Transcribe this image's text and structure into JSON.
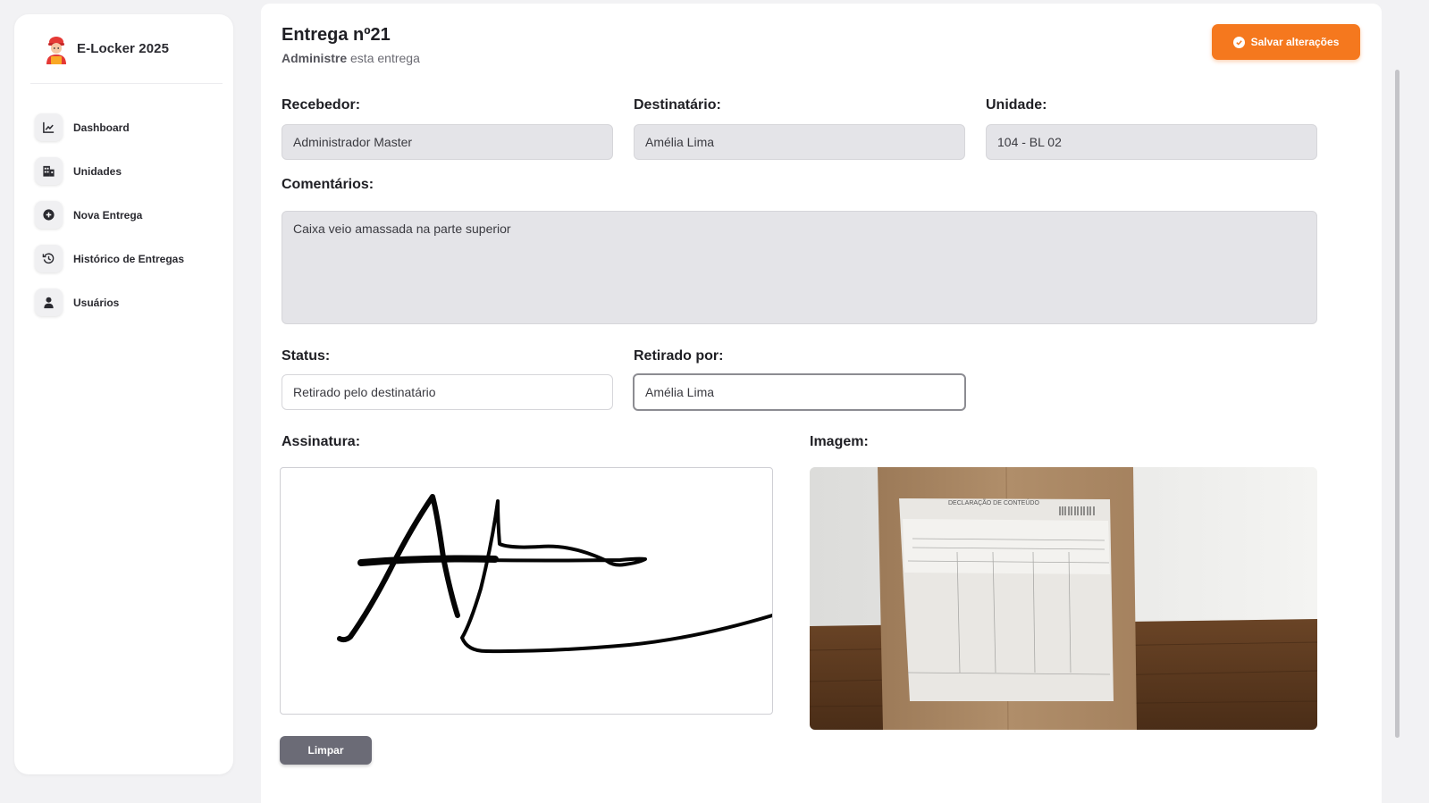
{
  "app": {
    "name": "E-Locker 2025"
  },
  "sidebar": {
    "items": [
      {
        "label": "Dashboard",
        "icon": "chart-line-icon"
      },
      {
        "label": "Unidades",
        "icon": "building-icon"
      },
      {
        "label": "Nova Entrega",
        "icon": "plus-circle-icon"
      },
      {
        "label": "Histórico de Entregas",
        "icon": "history-icon"
      },
      {
        "label": "Usuários",
        "icon": "user-icon"
      }
    ]
  },
  "header": {
    "title": "Entrega nº21",
    "subtitle_bold": "Administre",
    "subtitle_rest": " esta entrega",
    "save_label": "Salvar alterações"
  },
  "form": {
    "recebedor": {
      "label": "Recebedor:",
      "value": "Administrador Master"
    },
    "destinatario": {
      "label": "Destinatário:",
      "value": "Amélia Lima"
    },
    "unidade": {
      "label": "Unidade:",
      "value": "104 - BL 02"
    },
    "comentarios": {
      "label": "Comentários:",
      "value": "Caixa veio amassada na parte superior"
    },
    "status": {
      "label": "Status:",
      "value": "Retirado pelo destinatário"
    },
    "retirado_por": {
      "label": "Retirado por:",
      "value": "Amélia Lima"
    },
    "assinatura": {
      "label": "Assinatura:",
      "clear_label": "Limpar"
    },
    "imagem": {
      "label": "Imagem:"
    }
  },
  "photo": {
    "doc_heading": "DECLARAÇÃO DE CONTEÚDO"
  },
  "colors": {
    "accent": "#f5781e",
    "field_bg": "#e4e4e8",
    "clear_button": "#6b6b76"
  }
}
